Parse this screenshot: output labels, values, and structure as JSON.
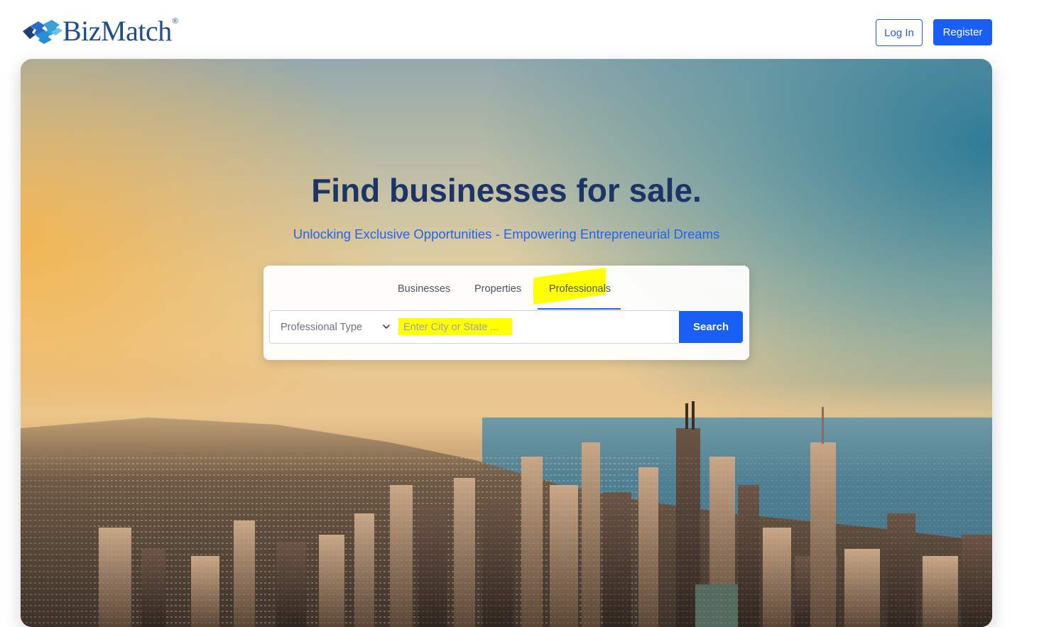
{
  "header": {
    "brand": "BizMatch",
    "brand_mark": "®",
    "login_label": "Log In",
    "register_label": "Register"
  },
  "hero": {
    "headline": "Find businesses for sale.",
    "subheadline": "Unlocking Exclusive Opportunities - Empowering Entrepreneurial Dreams"
  },
  "search": {
    "tabs": [
      {
        "label": "Businesses",
        "active": false
      },
      {
        "label": "Properties",
        "active": false
      },
      {
        "label": "Professionals",
        "active": true
      }
    ],
    "type_select": {
      "value": "Professional Type"
    },
    "location_input": {
      "placeholder": "Enter City or State ...",
      "value": ""
    },
    "search_label": "Search"
  },
  "colors": {
    "brand_blue": "#1a5ff5",
    "headline_navy": "#1d3466",
    "highlight_yellow": "#ffff00"
  },
  "icons": [
    "puzzle-logo-icon",
    "chevron-down-icon"
  ]
}
